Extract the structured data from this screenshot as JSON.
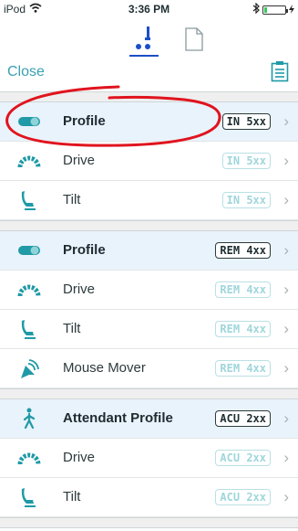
{
  "status_bar": {
    "carrier": "iPod",
    "time": "3:36 PM"
  },
  "toolbar": {
    "close_label": "Close"
  },
  "sections": [
    {
      "rows": [
        {
          "label": "Profile",
          "badge": "IN 5xx",
          "icon": "toggle-profile-icon",
          "header": true
        },
        {
          "label": "Drive",
          "badge": "IN 5xx",
          "icon": "speedometer-icon",
          "header": false
        },
        {
          "label": "Tilt",
          "badge": "IN 5xx",
          "icon": "wheelchair-seat-icon",
          "header": false
        }
      ]
    },
    {
      "rows": [
        {
          "label": "Profile",
          "badge": "REM 4xx",
          "icon": "toggle-profile-icon",
          "header": true
        },
        {
          "label": "Drive",
          "badge": "REM 4xx",
          "icon": "speedometer-icon",
          "header": false
        },
        {
          "label": "Tilt",
          "badge": "REM 4xx",
          "icon": "wheelchair-seat-icon",
          "header": false
        },
        {
          "label": "Mouse Mover",
          "badge": "REM 4xx",
          "icon": "mouse-cursor-icon",
          "header": false
        }
      ]
    },
    {
      "rows": [
        {
          "label": "Attendant Profile",
          "badge": "ACU 2xx",
          "icon": "walking-person-icon",
          "header": true
        },
        {
          "label": "Drive",
          "badge": "ACU 2xx",
          "icon": "speedometer-icon",
          "header": false
        },
        {
          "label": "Tilt",
          "badge": "ACU 2xx",
          "icon": "wheelchair-seat-icon",
          "header": false
        }
      ]
    }
  ],
  "colors": {
    "accent": "#3a9fb4",
    "icon": "#1f9aa6",
    "header_row_bg": "#e9f3fc",
    "highlight": "#e0141e",
    "active_tab": "#1a4fc8"
  }
}
